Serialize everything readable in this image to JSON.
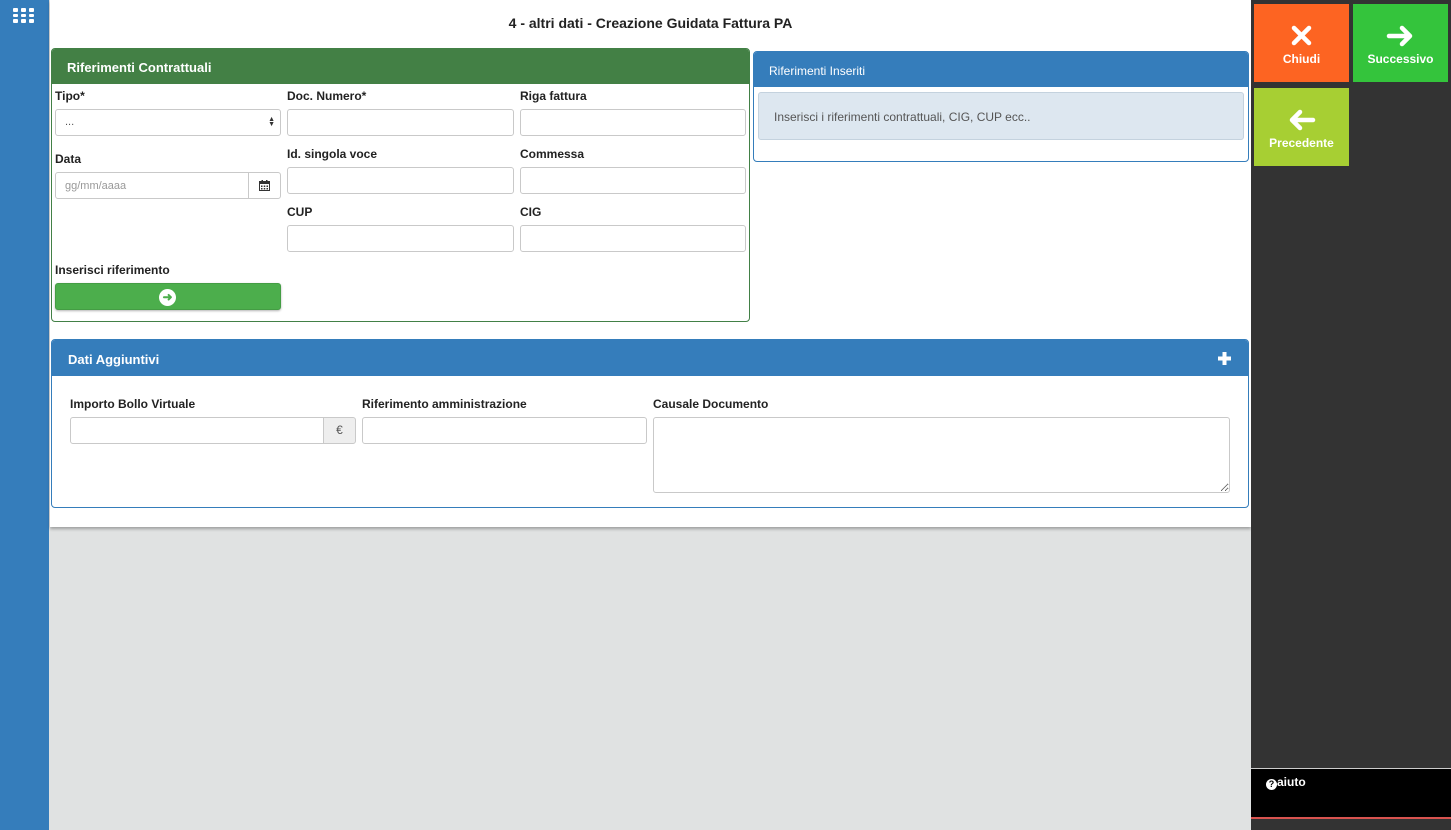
{
  "page": {
    "title": "4 - altri dati - Creazione Guidata Fattura PA"
  },
  "icons": {
    "apps": "grid-icon",
    "calendar": "calendar-icon",
    "arrow_right": "arrow-circle-right-icon",
    "plus": "plus-icon",
    "close": "x-icon",
    "next": "arrow-right-icon",
    "prev": "arrow-left-icon",
    "help": "question-circle-icon"
  },
  "colors": {
    "sidebar": "#357dbb",
    "panel_green": "#438045",
    "panel_blue": "#357dbb",
    "btn_close": "#fd6422",
    "btn_next": "#34c43c",
    "btn_prev": "#a7cf33",
    "btn_insert": "#4cae4c"
  },
  "riferimenti": {
    "header": "Riferimenti Contrattuali",
    "tipo_label": "Tipo*",
    "tipo_value": "...",
    "doc_numero_label": "Doc. Numero*",
    "riga_fattura_label": "Riga fattura",
    "data_label": "Data",
    "data_placeholder": "gg/mm/aaaa",
    "id_voce_label": "Id. singola voce",
    "commessa_label": "Commessa",
    "cup_label": "CUP",
    "cig_label": "CIG",
    "inserisci_label": "Inserisci riferimento"
  },
  "inseriti": {
    "header": "Riferimenti Inseriti",
    "info": "Inserisci i riferimenti contrattuali, CIG, CUP ecc.."
  },
  "aggiuntivi": {
    "header": "Dati Aggiuntivi",
    "bollo_label": "Importo Bollo Virtuale",
    "currency": "€",
    "rif_amm_label": "Riferimento amministrazione",
    "causale_label": "Causale Documento"
  },
  "nav": {
    "close_label": "Chiudi",
    "next_label": "Successivo",
    "prev_label": "Precedente"
  },
  "help": {
    "label": "aiuto"
  }
}
